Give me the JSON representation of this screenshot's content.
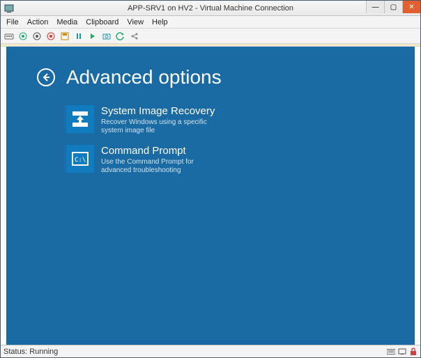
{
  "window": {
    "title": "APP-SRV1 on HV2 - Virtual Machine Connection"
  },
  "menubar": {
    "items": [
      "File",
      "Action",
      "Media",
      "Clipboard",
      "View",
      "Help"
    ]
  },
  "statusbar": {
    "text": "Status: Running"
  },
  "recovery": {
    "page_title": "Advanced options",
    "tiles": [
      {
        "title": "System Image Recovery",
        "desc": "Recover Windows using a specific system image file"
      },
      {
        "title": "Command Prompt",
        "desc": "Use the Command Prompt for advanced troubleshooting"
      }
    ]
  }
}
